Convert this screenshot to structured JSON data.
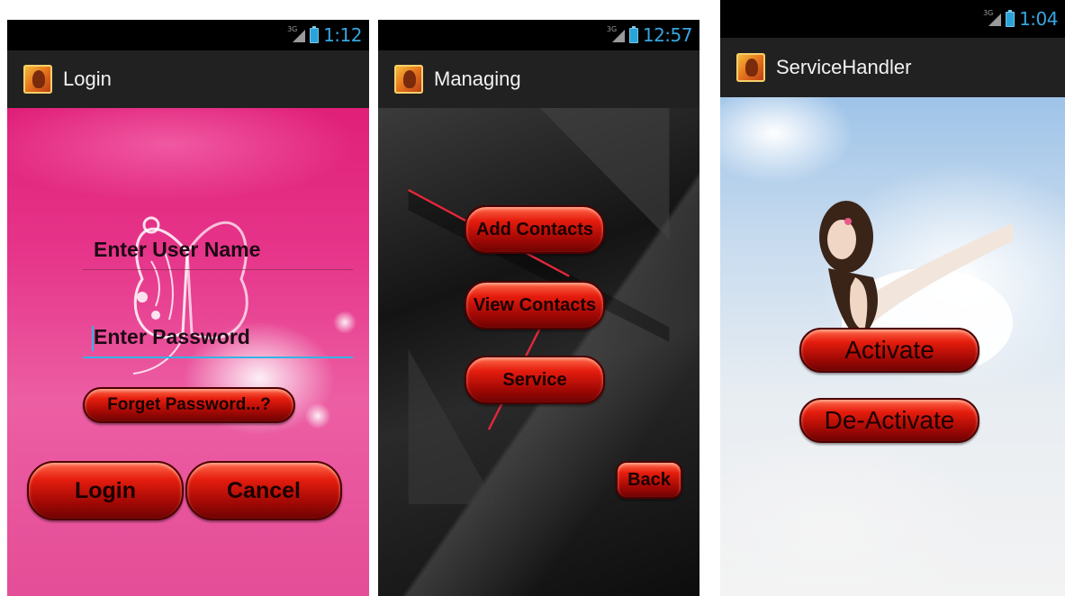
{
  "status": {
    "network": "3G",
    "time_login": "1:12",
    "time_managing": "12:57",
    "time_service": "1:04"
  },
  "login_screen": {
    "title": "Login",
    "username_placeholder": "Enter User Name",
    "password_placeholder": "Enter Password",
    "forget_label": "Forget Password...?",
    "login_label": "Login",
    "cancel_label": "Cancel"
  },
  "managing_screen": {
    "title": "Managing",
    "add_contacts_label": "Add Contacts",
    "view_contacts_label": "View Contacts",
    "service_label": "Service",
    "back_label": "Back"
  },
  "service_screen": {
    "title": "ServiceHandler",
    "activate_label": "Activate",
    "deactivate_label": "De-Activate"
  },
  "icons": [
    "signal-icon",
    "battery-icon",
    "app-icon"
  ],
  "colors": {
    "button_red": "#d4150a",
    "clock_blue": "#36a6e0",
    "input_focus": "#33b5e5",
    "actionbar": "#212121"
  }
}
